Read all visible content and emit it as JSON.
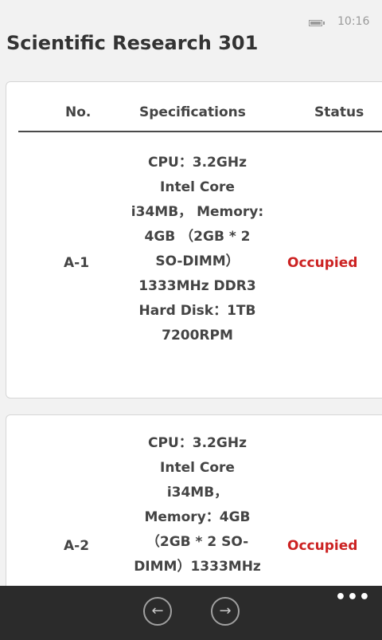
{
  "status_bar": {
    "time": "10:16",
    "icons": [
      "battery-icon"
    ]
  },
  "page": {
    "title": "Scientific Research 301"
  },
  "table": {
    "headers": {
      "no": "No.",
      "specifications": "Specifications",
      "status": "Status"
    },
    "rows": [
      {
        "no": "A-1",
        "spec_lines": [
          "CPU：3.2GHz",
          "Intel Core",
          "i34MB， Memory:",
          "4GB （2GB * 2",
          "SO-DIMM）",
          "1333MHz DDR3",
          "Hard Disk：1TB",
          "7200RPM"
        ],
        "status": "Occupied"
      },
      {
        "no": "A-2",
        "spec_lines": [
          "CPU：3.2GHz",
          "Intel Core",
          "i34MB，",
          "Memory：4GB",
          "（2GB * 2 SO-",
          "DIMM）1333MHz"
        ],
        "status": "Occupied"
      }
    ]
  },
  "app_bar": {
    "back_icon": "←",
    "forward_icon": "→",
    "more_label": "•••",
    "icons": [
      "back-arrow-icon",
      "forward-arrow-icon",
      "more-icon"
    ]
  },
  "colors": {
    "status_occupied": "#cc2222",
    "app_bar_bg": "#2b2b2b",
    "page_bg": "#f2f2f2"
  }
}
